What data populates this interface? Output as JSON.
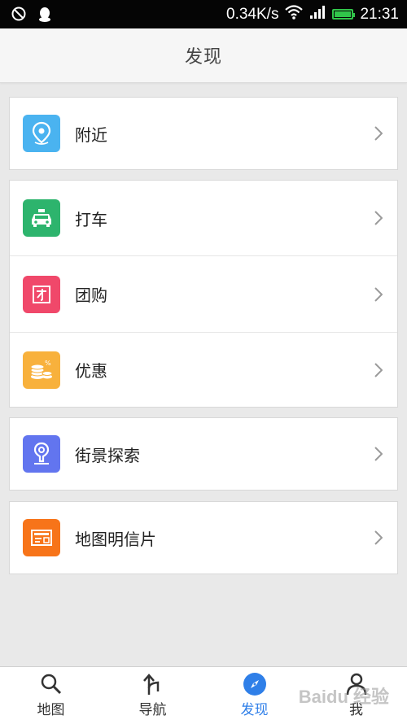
{
  "status_bar": {
    "speed": "0.34K/s",
    "time": "21:31",
    "battery_level": 0.9,
    "icons": [
      "notification-icon",
      "qq-icon",
      "wifi-icon",
      "signal-icon",
      "battery-icon"
    ]
  },
  "header": {
    "title": "发现"
  },
  "groups": [
    {
      "items": [
        {
          "label": "附近",
          "icon": "location-pin-icon",
          "color": "#4ab3f0"
        }
      ]
    },
    {
      "items": [
        {
          "label": "打车",
          "icon": "taxi-icon",
          "color": "#2db46d"
        },
        {
          "label": "团购",
          "icon": "group-buy-icon",
          "color": "#f0486a"
        },
        {
          "label": "优惠",
          "icon": "coupon-coins-icon",
          "color": "#f8b13c"
        }
      ]
    },
    {
      "items": [
        {
          "label": "街景探索",
          "icon": "street-view-icon",
          "color": "#6275ef"
        }
      ]
    },
    {
      "items": [
        {
          "label": "地图明信片",
          "icon": "postcard-icon",
          "color": "#f77419"
        }
      ]
    }
  ],
  "bottom_nav": {
    "items": [
      {
        "label": "地图",
        "icon": "search-icon",
        "active": false
      },
      {
        "label": "导航",
        "icon": "navigation-arrow-icon",
        "active": false
      },
      {
        "label": "发现",
        "icon": "compass-icon",
        "active": true
      },
      {
        "label": "我",
        "icon": "person-icon",
        "active": false
      }
    ],
    "active_color": "#2f7fe8"
  },
  "watermark": "Baidu 经验"
}
